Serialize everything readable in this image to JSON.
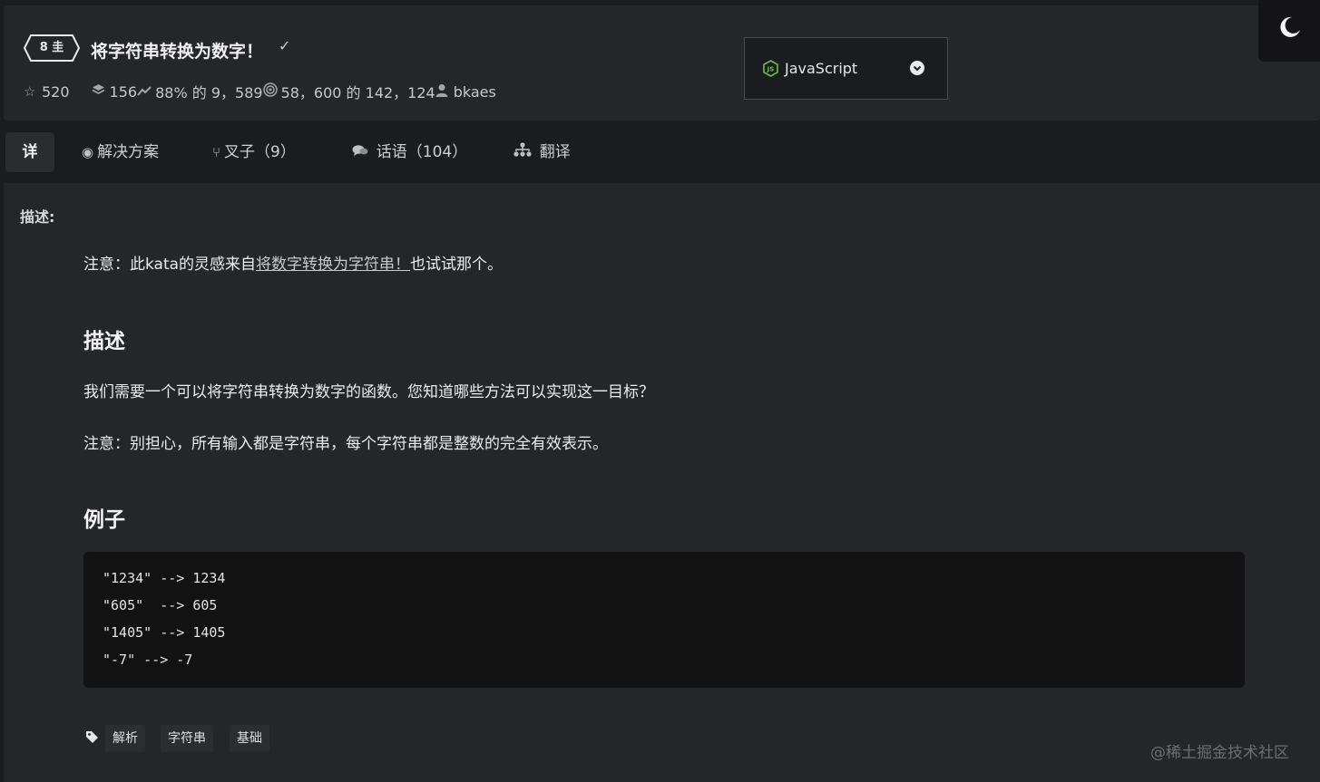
{
  "header": {
    "rank": "8 kyu",
    "rank_label": "8 圭",
    "title": "将字符串转换为数字！",
    "check_glyph": "✓",
    "stats": {
      "stars": "520",
      "collections": "156",
      "satisfaction": "88% 的 9，589",
      "completed": "58，600 的 142，124",
      "author": "bkaes"
    },
    "language": "JavaScript"
  },
  "tabs": [
    {
      "label": "详"
    },
    {
      "label": "解决方案"
    },
    {
      "label": "叉子（9）"
    },
    {
      "label": "话语（104）"
    },
    {
      "label": "翻译"
    }
  ],
  "content": {
    "section_label": "描述:",
    "note_prefix": "注意：此kata的灵感来自",
    "note_link": "将数字转换为字符串！",
    "note_suffix": "也试试那个。",
    "heading_desc": "描述",
    "para1": "我们需要一个可以将字符串转换为数字的函数。您知道哪些方法可以实现这一目标？",
    "para2": "注意：别担心，所有输入都是字符串，每个字符串都是整数的完全有效表示。",
    "heading_examples": "例子",
    "code_lines": [
      "\"1234\" --> 1234",
      "\"605\"  --> 605",
      "\"1405\" --> 1405",
      "\"-7\" --> -7"
    ],
    "tags": [
      "解析",
      "字符串",
      "基础"
    ]
  },
  "watermark": "@稀土掘金技术社区",
  "icons": {
    "star": "star-icon",
    "collections": "layers-icon",
    "satisfaction": "thumbs-icon",
    "completed": "target-icon",
    "author": "user-icon",
    "language": "nodejs-icon",
    "dropdown": "chevron-down-circle-icon",
    "theme": "moon-icon",
    "tag": "tag-icon"
  },
  "colors": {
    "background": "#1b1c1f",
    "panel": "#25262a",
    "code_bg": "#121213",
    "node_green": "#6cc24a"
  }
}
